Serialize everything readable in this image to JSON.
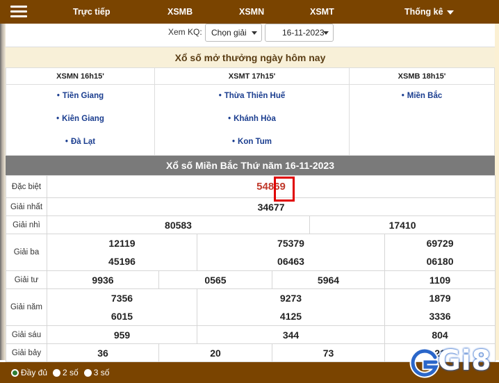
{
  "nav": {
    "items": [
      "Trực tiếp",
      "XSMB",
      "XSMN",
      "XSMT",
      "Thống kê"
    ],
    "colors": {
      "bar": "#7a4400",
      "text": "#ffffff"
    }
  },
  "filter": {
    "label": "Xem KQ:",
    "region_select": "Chọn giải",
    "date_select": "16-11-2023"
  },
  "today": {
    "title": "Xổ số mở thưởng ngày hôm nay",
    "columns": [
      {
        "heading": "XSMN 16h15'",
        "items": [
          "Tiền Giang",
          "Kiên Giang",
          "Đà Lạt"
        ]
      },
      {
        "heading": "XSMT 17h15'",
        "items": [
          "Thừa Thiên Huế",
          "Khánh Hòa",
          "Kon Tum"
        ]
      },
      {
        "heading": "XSMB 18h15'",
        "items": [
          "Miền Bắc"
        ]
      }
    ]
  },
  "results": {
    "title": "Xổ số Miền Bắc Thứ năm 16-11-2023",
    "prizes": [
      {
        "label": "Đặc biệt",
        "numbers": [
          "54869"
        ]
      },
      {
        "label": "Giải nhất",
        "numbers": [
          "34677"
        ]
      },
      {
        "label": "Giải nhì",
        "numbers": [
          "80583",
          "17410"
        ]
      },
      {
        "label": "Giải ba",
        "numbers": [
          "12119",
          "75379",
          "69729",
          "45196",
          "06463",
          "06180"
        ]
      },
      {
        "label": "Giải tư",
        "numbers": [
          "9936",
          "0565",
          "5964",
          "1109"
        ]
      },
      {
        "label": "Giải năm",
        "numbers": [
          "7356",
          "9273",
          "1879",
          "6015",
          "4125",
          "3336"
        ]
      },
      {
        "label": "Giải sáu",
        "numbers": [
          "959",
          "344",
          "804"
        ]
      },
      {
        "label": "Giải bảy",
        "numbers": [
          "36",
          "20",
          "73",
          "21"
        ]
      }
    ],
    "special_color": "#c0392b",
    "highlight_color": "#e00000"
  },
  "display_options": {
    "options": [
      "Đầy đủ",
      "2 số",
      "3 số"
    ],
    "selected": "Đầy đủ"
  },
  "watermark": {
    "text": "Gi8",
    "color": "#2a66c9"
  }
}
